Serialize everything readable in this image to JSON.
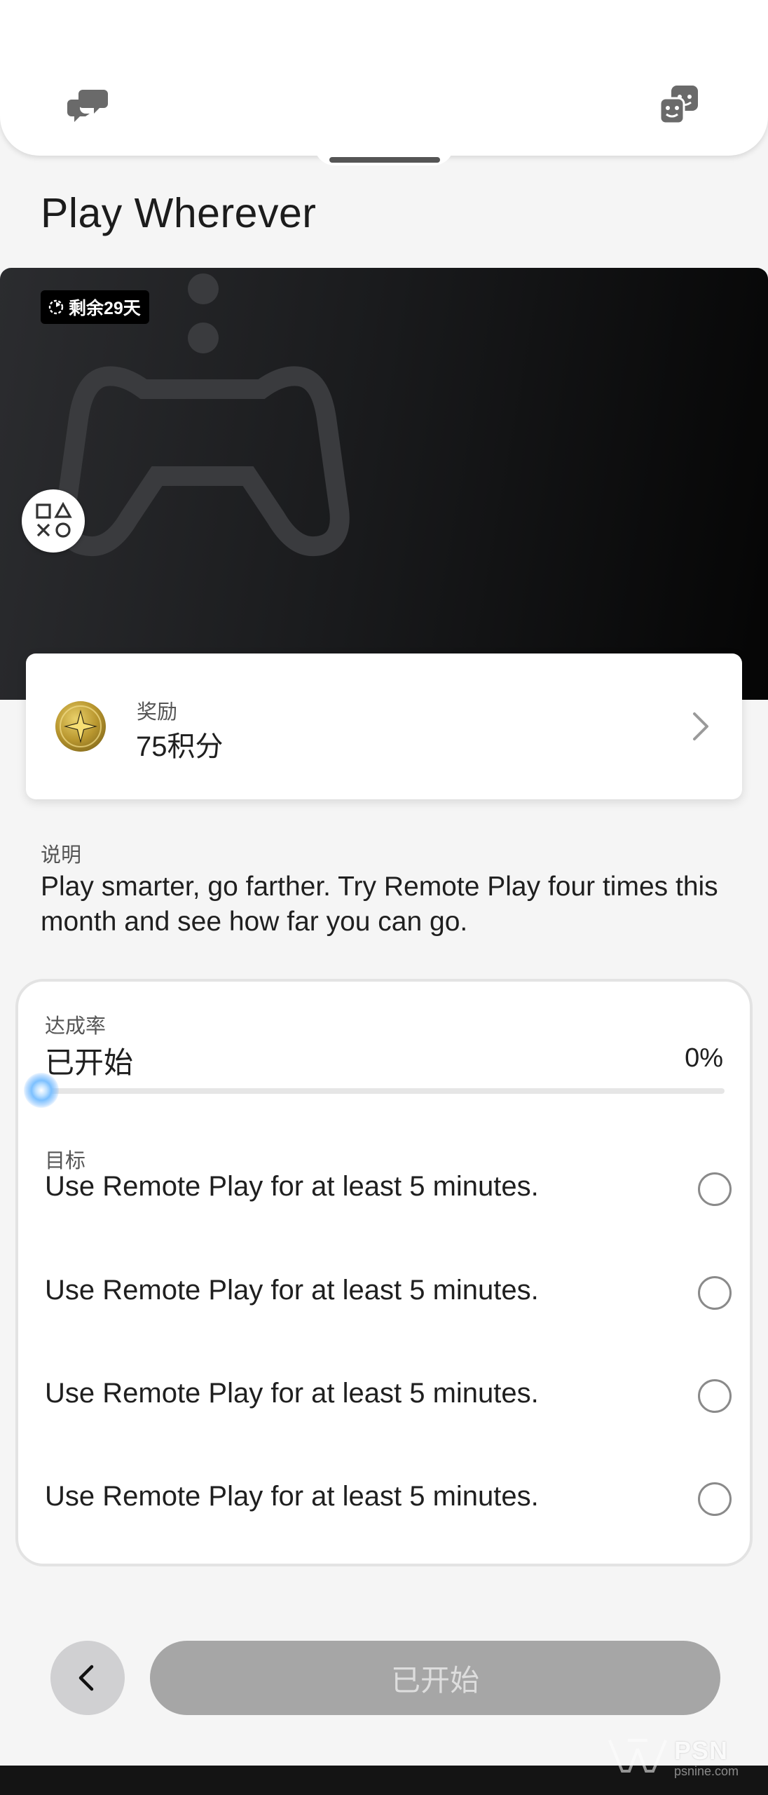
{
  "page": {
    "title": "Play Wherever"
  },
  "hero": {
    "days_left_badge": "剩余29天"
  },
  "reward": {
    "label": "奖励",
    "value": "75积分"
  },
  "description": {
    "label": "说明",
    "text": "Play smarter, go farther. Try Remote Play four times this month and see how far you can go."
  },
  "progress": {
    "label": "达成率",
    "status": "已开始",
    "percent_text": "0%",
    "percent_value": 0,
    "accent_color": "#4aa8ff"
  },
  "goals": {
    "label": "目标",
    "items": [
      {
        "text": "Use Remote Play for at least 5 minutes.",
        "completed": false
      },
      {
        "text": "Use Remote Play for at least 5 minutes.",
        "completed": false
      },
      {
        "text": "Use Remote Play for at least 5 minutes.",
        "completed": false
      },
      {
        "text": "Use Remote Play for at least 5 minutes.",
        "completed": false
      }
    ]
  },
  "bottom_bar": {
    "back_icon": "chevron-left-icon",
    "action_label": "已开始"
  },
  "watermark": {
    "brand": "PSN",
    "small_text": "psnine.com"
  },
  "icons": {
    "top_left": "chat-bubbles-icon",
    "top_right": "friends-icon",
    "hero_art": "controller-icon",
    "ps_badge": "playstation-shapes-icon",
    "reward": "coin-star-icon",
    "card_arrow": "chevron-right-icon"
  }
}
